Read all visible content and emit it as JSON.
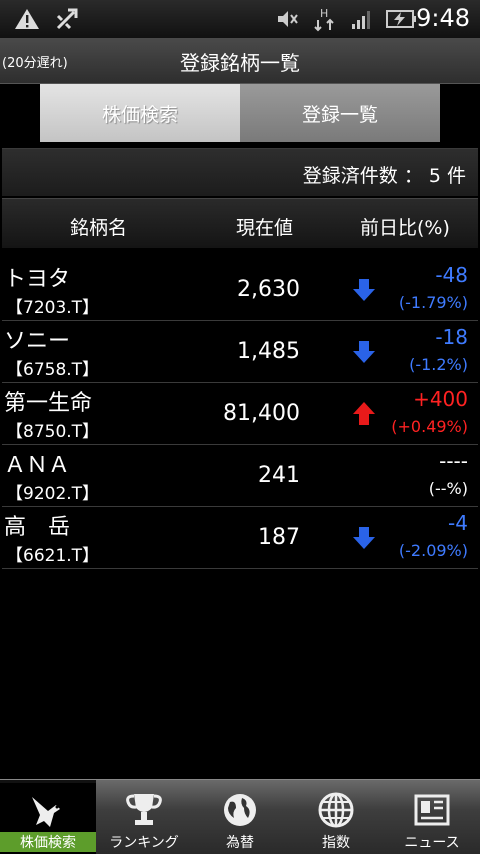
{
  "status_bar": {
    "time": "9:48"
  },
  "title_bar": {
    "delay_note": "(20分遅れ)",
    "title": "登録銘柄一覧"
  },
  "tabs": [
    {
      "label": "株価検索",
      "active": true
    },
    {
      "label": "登録一覧",
      "active": false
    }
  ],
  "count_bar": {
    "label": "登録済件数 ： 5 件"
  },
  "table": {
    "headers": {
      "name": "銘柄名",
      "price": "現在値",
      "change": "前日比(%)"
    },
    "rows": [
      {
        "name": "トヨタ",
        "code": "【7203.T】",
        "price": "2,630",
        "change": "-48",
        "percent": "(-1.79%)",
        "direction": "down"
      },
      {
        "name": "ソニー",
        "code": "【6758.T】",
        "price": "1,485",
        "change": "-18",
        "percent": "(-1.2%)",
        "direction": "down"
      },
      {
        "name": "第一生命",
        "code": "【8750.T】",
        "price": "81,400",
        "change": "+400",
        "percent": "(+0.49%)",
        "direction": "up"
      },
      {
        "name": "ＡＮＡ",
        "code": "【9202.T】",
        "price": "241",
        "change": "----",
        "percent": "(--%)",
        "direction": "flat"
      },
      {
        "name": "高　岳",
        "code": "【6621.T】",
        "price": "187",
        "change": "-4",
        "percent": "(-2.09%)",
        "direction": "down"
      }
    ]
  },
  "nav": [
    {
      "label": "株価検索",
      "icon": "bird-icon",
      "active": true
    },
    {
      "label": "ランキング",
      "icon": "trophy-icon",
      "active": false
    },
    {
      "label": "為替",
      "icon": "globe-icon",
      "active": false
    },
    {
      "label": "指数",
      "icon": "grid-globe-icon",
      "active": false
    },
    {
      "label": "ニュース",
      "icon": "newspaper-icon",
      "active": false
    }
  ],
  "colors": {
    "down": "#3f7bff",
    "up": "#ff2222",
    "active_nav": "#5d9d2b"
  }
}
